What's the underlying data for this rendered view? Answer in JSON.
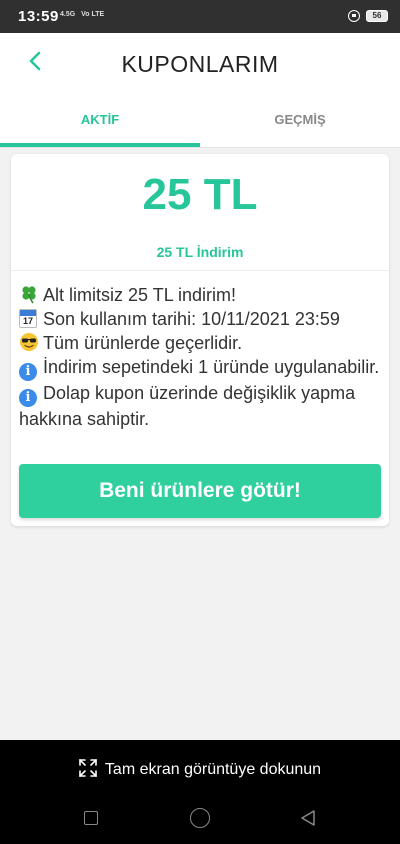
{
  "status_bar": {
    "time": "13:59",
    "signal": "4.5G",
    "volte": "Vo LTE",
    "battery": "56"
  },
  "header": {
    "title": "KUPONLARIM",
    "back_icon": "chevron-left-icon"
  },
  "tabs": [
    {
      "label": "AKTİF",
      "active": true
    },
    {
      "label": "GEÇMİŞ",
      "active": false
    }
  ],
  "coupon": {
    "amount": "25 TL",
    "discount_label": "25 TL İndirim",
    "terms": [
      {
        "icon": "clover-icon",
        "text": "Alt limitsiz 25 TL indirim!"
      },
      {
        "icon": "calendar-icon",
        "calendar_month": "July",
        "calendar_day": "17",
        "text": "Son kullanım tarihi: 10/11/2021 23:59"
      },
      {
        "icon": "sunglasses-face-icon",
        "text": "Tüm ürünlerde geçerlidir."
      },
      {
        "icon": "info-icon",
        "text": "İndirim sepetindeki 1 üründe uygulanabilir."
      },
      {
        "icon": "info-icon",
        "text": "Dolap kupon üzerinde değişiklik yapma hakkına sahiptir."
      }
    ],
    "cta_label": "Beni ürünlere götür!"
  },
  "colors": {
    "accent": "#27c59a",
    "button": "#2fcf9e"
  },
  "system": {
    "fullscreen_hint": "Tam ekran görüntüye dokunun"
  }
}
